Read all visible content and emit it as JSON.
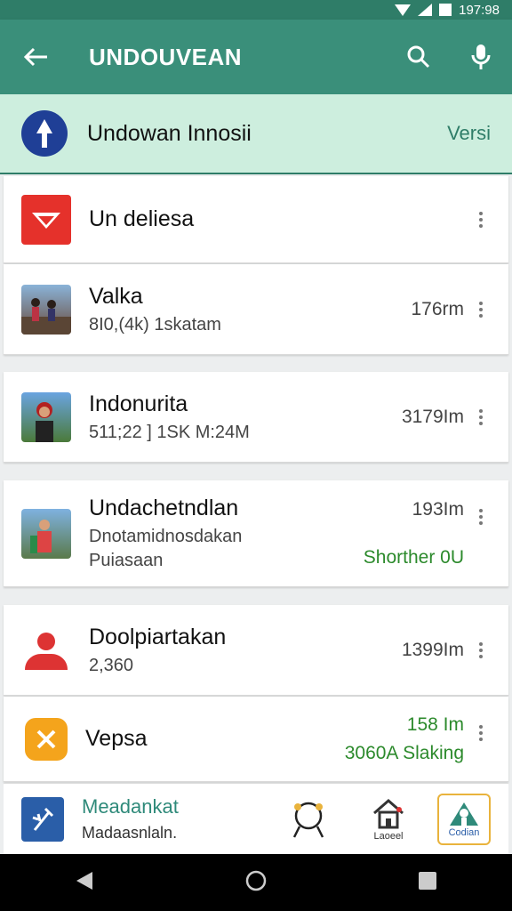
{
  "status": {
    "time": "197:98"
  },
  "appbar": {
    "title": "UNDOUVEAN"
  },
  "banner": {
    "name": "Undowan Innosii",
    "version": "Versi"
  },
  "list": [
    {
      "title": "Un deliesa",
      "subtitle": "",
      "right": "",
      "right2": ""
    },
    {
      "title": "Valka",
      "subtitle": "8I0,(4k) 1skatam",
      "right": "176rm",
      "right2": ""
    },
    {
      "title": "Indonurita",
      "subtitle": "511;22 ] 1SK M:24M",
      "right": "3179Im",
      "right2": ""
    },
    {
      "title": "Undachetndlan",
      "subtitle": "Dnotamidnosdakan",
      "subtitle2": "Puiasaan",
      "right": "193Im",
      "right2": "Shorther 0U"
    },
    {
      "title": "Doolpiartakan",
      "subtitle": "2,360",
      "right": "1399Im",
      "right2": ""
    },
    {
      "title": "Vepsa",
      "subtitle": "",
      "right": "158 Im",
      "right2": "3060A Slaking"
    }
  ],
  "bottomnav": {
    "title": "Meadankat",
    "subtitle": "Madaasnlaln.",
    "home_label": "Laoeel",
    "active_label": "Codian"
  },
  "colors": {
    "primary": "#3a8f7a",
    "banner_bg": "#cdeede",
    "accent_green": "#2c8a2c",
    "active_nav": "#e9b33c"
  }
}
